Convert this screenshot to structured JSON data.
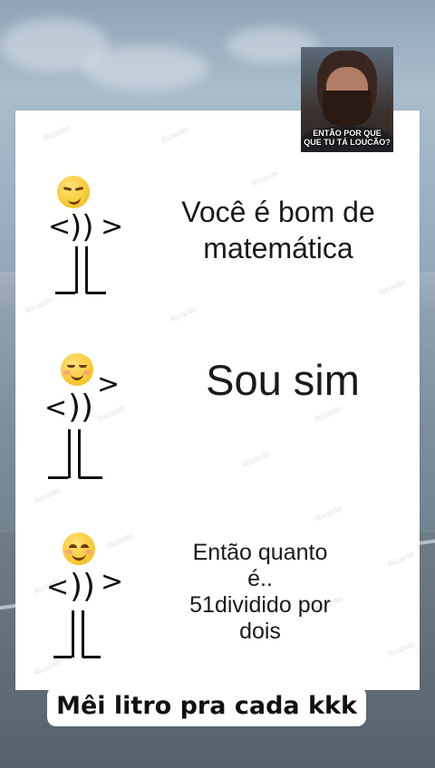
{
  "panels": [
    {
      "text_lines": [
        "Você é bom de",
        "matemática"
      ],
      "emoji": "smirking-face-icon"
    },
    {
      "text_lines": [
        "Sou sim"
      ],
      "emoji": "relieved-face-icon"
    },
    {
      "text_lines": [
        "Então quanto",
        "é..",
        "51dividido por",
        "dois"
      ],
      "emoji": "smiling-blush-face-icon"
    }
  ],
  "camera_overlay": {
    "caption_lines": [
      "ENTÃO POR QUE",
      "QUE TU TÁ LOUCÃO?"
    ]
  },
  "bottom_caption": "Mêi litro pra cada kkk",
  "watermark": "Ricardo"
}
